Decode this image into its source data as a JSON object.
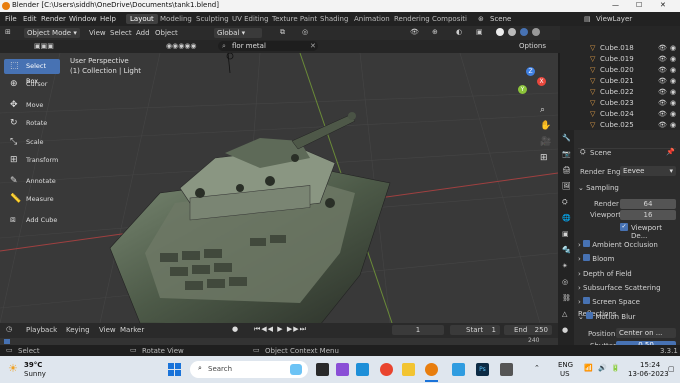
{
  "window": {
    "title": "Blender [C:\\Users\\siddh\\OneDrive\\Documents\\tank1.blend]",
    "min": "—",
    "max": "☐",
    "close": "✕"
  },
  "menu": {
    "items": [
      "File",
      "Edit",
      "Render",
      "Window",
      "Help"
    ]
  },
  "workspaces": [
    "Layout",
    "Modeling",
    "Sculpting",
    "UV Editing",
    "Texture Paint",
    "Shading",
    "Animation",
    "Rendering",
    "Compositi"
  ],
  "scene_label": "Scene",
  "viewlayer_label": "ViewLayer",
  "header": {
    "mode": "Object Mode",
    "menus": [
      "View",
      "Select",
      "Add",
      "Object"
    ],
    "orientation": "Global",
    "options_label": "Options"
  },
  "search": {
    "value": "flor metal"
  },
  "viewport": {
    "perspective": "User Perspective",
    "collection": "(1) Collection | Light"
  },
  "tools": [
    "Select Box",
    "Cursor",
    "Move",
    "Rotate",
    "Scale",
    "Transform",
    "Annotate",
    "Measure",
    "Add Cube"
  ],
  "gizmo": {
    "x": "X",
    "y": "Y",
    "z": "Z"
  },
  "outliner": {
    "items": [
      "Cube.018",
      "Cube.019",
      "Cube.020",
      "Cube.021",
      "Cube.022",
      "Cube.023",
      "Cube.024",
      "Cube.025"
    ]
  },
  "properties": {
    "scene_title": "Scene",
    "render_engine_label": "Render Engi",
    "render_engine_value": "Eevee",
    "sampling_label": "Sampling",
    "render_label": "Render",
    "render_value": "64",
    "viewport_label": "Viewport",
    "viewport_value": "16",
    "viewport_denoise": "Viewport De...",
    "sections": [
      "Ambient Occlusion",
      "Bloom",
      "Depth of Field",
      "Subsurface Scattering",
      "Screen Space Reflections",
      "Motion Blur"
    ],
    "position_label": "Position",
    "position_value": "Center on ...",
    "shutter_label": "Shutter",
    "shutter_value": "0.50"
  },
  "timeline": {
    "menus": [
      "Playback",
      "Keying",
      "View",
      "Marker"
    ],
    "current_frame": "1",
    "start_label": "Start",
    "start_value": "1",
    "end_label": "End",
    "end_value": "250",
    "ruler_end": "240"
  },
  "statusbar": {
    "select": "Select",
    "rotate": "Rotate View",
    "context": "Object Context Menu",
    "version": "3.3.1"
  },
  "taskbar": {
    "temp": "39°C",
    "weather": "Sunny",
    "search_placeholder": "Search",
    "lang1": "ENG",
    "lang2": "US",
    "time": "15:24",
    "date": "13-06-2023"
  },
  "colors": {
    "accent": "#4772b3",
    "blender_orange": "#e87d0d",
    "x_axis": "#e8473c",
    "y_axis": "#8cc43a",
    "z_axis": "#3f7fe0"
  }
}
